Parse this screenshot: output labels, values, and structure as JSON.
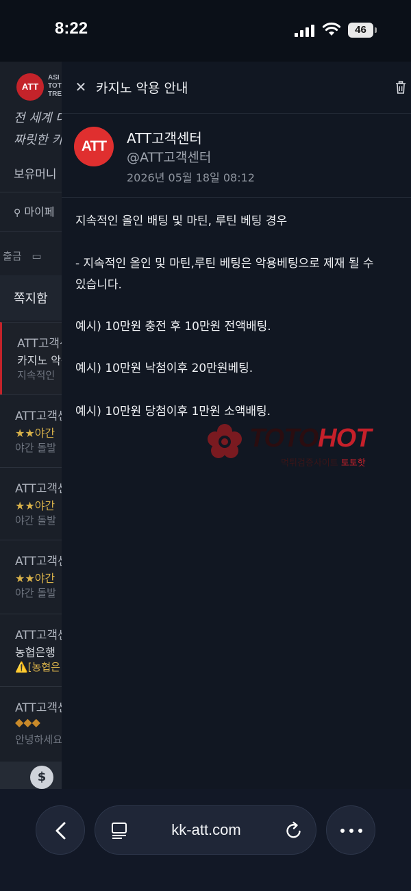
{
  "status_bar": {
    "time": "8:22",
    "battery": "46",
    "icons": [
      "signal-icon",
      "wifi-icon",
      "battery-icon"
    ]
  },
  "background_page": {
    "logo": "ATT",
    "logo_text_lines": [
      "ASI",
      "TOT",
      "TRE"
    ],
    "slogan_lines": [
      "전 세계 대",
      "짜릿한 카"
    ],
    "balance_label": "보유머니",
    "mypage_label": "마이페",
    "withdraw_label": "출금",
    "tab_label": "쪽지함",
    "messages": [
      {
        "sender": "ATT고객센",
        "subject": "카지노 악용",
        "preview": "지속적인"
      },
      {
        "sender": "ATT고객센",
        "subject": "★★야간",
        "preview": "야간 돌발"
      },
      {
        "sender": "ATT고객센",
        "subject": "★★야간",
        "preview": "야간 돌발"
      },
      {
        "sender": "ATT고객센",
        "subject": "★★야간",
        "preview": "야간 돌발"
      },
      {
        "sender": "ATT고객센",
        "subject": "농협은행",
        "preview": "⚠️[농협은"
      },
      {
        "sender": "ATT고객센",
        "subject": "◆◆◆",
        "preview": "안녕하세요"
      }
    ]
  },
  "modal": {
    "title": "카지노 악용 안내",
    "sender": {
      "avatar": "ATT",
      "name": "ATT고객센터",
      "handle": "@ATT고객센터",
      "date": "2026년 05월 18일 08:12"
    },
    "body": {
      "heading": "지속적인 올인 배팅 및 마틴, 루틴 베팅 경우",
      "warning_line1": "- 지속적인 올인 및 마틴,루틴 베팅은 악용베팅으로 제재 될 수",
      "warning_line2": "있습니다.",
      "examples": [
        "예시) 10만원 충전 후 10만원 전액배팅.",
        "예시) 10만원 낙첨이후 20만원베팅.",
        "예시) 10만원 당첨이후 1만원 소액배팅."
      ]
    }
  },
  "watermark": {
    "brand_part1": "TOTO",
    "brand_part2": "HOT",
    "tagline_part1": "먹튀검증사이트",
    "tagline_part2": "토토핫"
  },
  "browser_bar": {
    "url": "kk-att.com"
  },
  "colors": {
    "accent_red": "#e02f2f",
    "modal_bg": "#111722",
    "page_bg": "#0b1018"
  }
}
